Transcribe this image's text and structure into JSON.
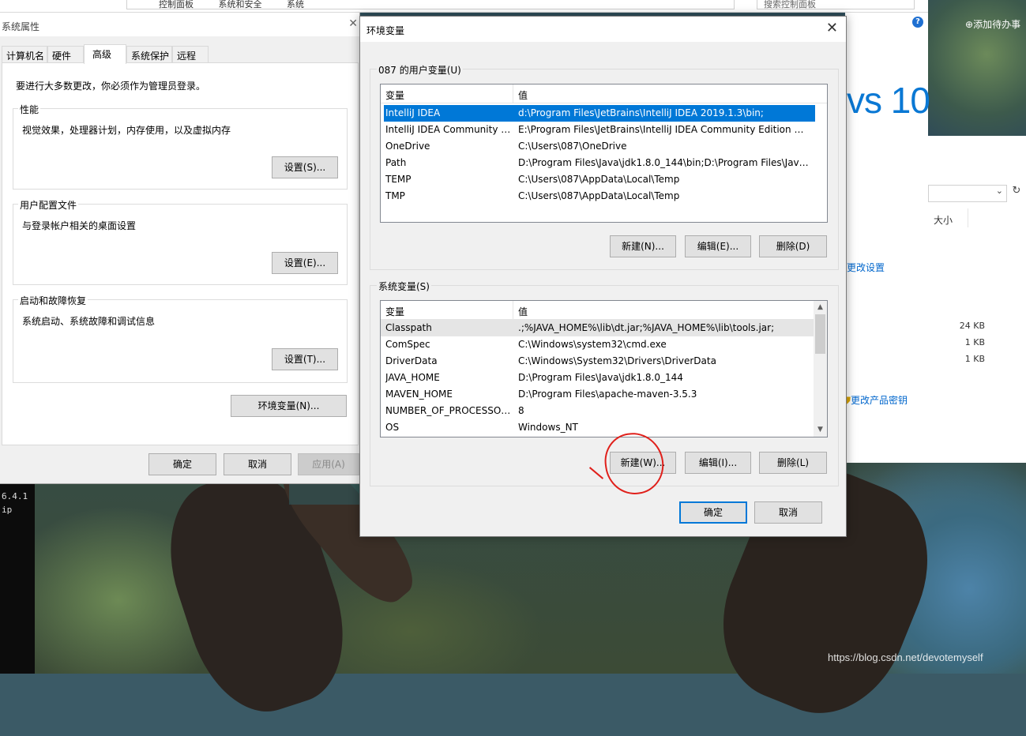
{
  "background": {
    "breadcrumb": [
      "控制面板",
      "系统和安全",
      "系统"
    ],
    "search_placeholder": "搜索控制面板",
    "todo_tab": "添加待办事",
    "win10_text": "vs 10",
    "change_settings_link": "更改设置",
    "size_header": "大小",
    "file_sizes": [
      "24 KB",
      "1 KB",
      "1 KB"
    ],
    "change_key_link": "更改产品密钥",
    "terminal_lines": [
      "6.4.1",
      "ip"
    ],
    "watermark": "https://blog.csdn.net/devotemyself"
  },
  "sysprop": {
    "title": "系统属性",
    "tabs": [
      "计算机名",
      "硬件",
      "高级",
      "系统保护",
      "远程"
    ],
    "active_tab": "高级",
    "admin_note": "要进行大多数更改，你必须作为管理员登录。",
    "performance": {
      "title": "性能",
      "desc": "视觉效果，处理器计划，内存使用，以及虚拟内存",
      "button": "设置(S)..."
    },
    "profile": {
      "title": "用户配置文件",
      "desc": "与登录帐户相关的桌面设置",
      "button": "设置(E)..."
    },
    "startup": {
      "title": "启动和故障恢复",
      "desc": "系统启动、系统故障和调试信息",
      "button": "设置(T)..."
    },
    "env_button": "环境变量(N)...",
    "ok": "确定",
    "cancel": "取消",
    "apply": "应用(A)"
  },
  "envdlg": {
    "title": "环境变量",
    "user_group_title": "087 的用户变量(U)",
    "user_headers": [
      "变量",
      "值"
    ],
    "user_rows": [
      [
        "IntelliJ IDEA",
        "d:\\Program Files\\JetBrains\\IntelliJ IDEA 2019.1.3\\bin;"
      ],
      [
        "IntelliJ IDEA Community E...",
        "E:\\Program Files\\JetBrains\\IntelliJ IDEA Community Edition 20..."
      ],
      [
        "OneDrive",
        "C:\\Users\\087\\OneDrive"
      ],
      [
        "Path",
        "D:\\Program Files\\Java\\jdk1.8.0_144\\bin;D:\\Program Files\\Java..."
      ],
      [
        "TEMP",
        "C:\\Users\\087\\AppData\\Local\\Temp"
      ],
      [
        "TMP",
        "C:\\Users\\087\\AppData\\Local\\Temp"
      ]
    ],
    "user_buttons": [
      "新建(N)...",
      "编辑(E)...",
      "删除(D)"
    ],
    "system_group_title": "系统变量(S)",
    "system_headers": [
      "变量",
      "值"
    ],
    "system_rows": [
      [
        "Classpath",
        ".;%JAVA_HOME%\\lib\\dt.jar;%JAVA_HOME%\\lib\\tools.jar;"
      ],
      [
        "ComSpec",
        "C:\\Windows\\system32\\cmd.exe"
      ],
      [
        "DriverData",
        "C:\\Windows\\System32\\Drivers\\DriverData"
      ],
      [
        "JAVA_HOME",
        "D:\\Program Files\\Java\\jdk1.8.0_144"
      ],
      [
        "MAVEN_HOME",
        "D:\\Program Files\\apache-maven-3.5.3"
      ],
      [
        "NUMBER_OF_PROCESSORS",
        "8"
      ],
      [
        "OS",
        "Windows_NT"
      ]
    ],
    "system_buttons": [
      "新建(W)...",
      "编辑(I)...",
      "删除(L)"
    ],
    "ok": "确定",
    "cancel": "取消"
  },
  "colors": {
    "selection": "#0078d7",
    "annotation": "#e0201b",
    "win_blue": "#0a78d4"
  }
}
